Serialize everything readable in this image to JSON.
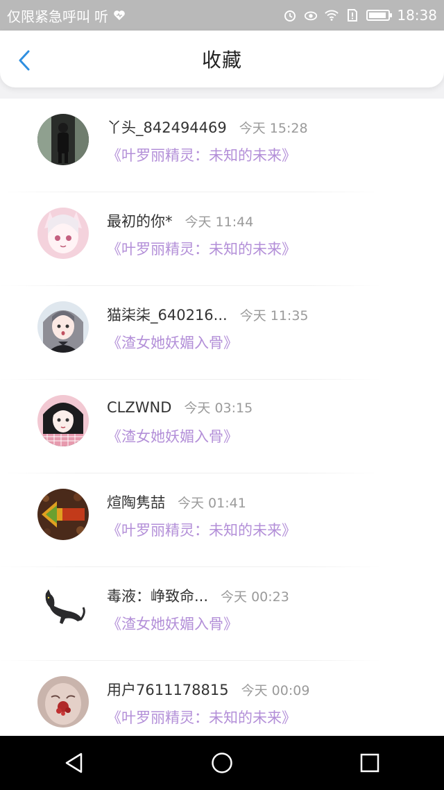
{
  "status_bar": {
    "left_text": "仅限紧急呼叫",
    "carrier_icon": "听",
    "time": "18:38",
    "icons": [
      "heart-icon",
      "alarm-icon",
      "eye-icon",
      "wifi-icon",
      "sim-alert-icon",
      "battery-icon"
    ]
  },
  "header": {
    "title": "收藏",
    "back_icon": "chevron-left-icon",
    "accent_color": "#2f8fe0"
  },
  "items": [
    {
      "username": "丫头_842494469",
      "time": "今天 15:28",
      "book": "《叶罗丽精灵：未知的未来》"
    },
    {
      "username": "最初的你*",
      "time": "今天 11:44",
      "book": "《叶罗丽精灵：未知的未来》"
    },
    {
      "username": "猫柒柒_640216...",
      "time": "今天 11:35",
      "book": "《渣女她妖媚入骨》"
    },
    {
      "username": "CLZWND",
      "time": "今天 03:15",
      "book": "《渣女她妖媚入骨》"
    },
    {
      "username": "煊陶隽喆",
      "time": "今天 01:41",
      "book": "《叶罗丽精灵：未知的未来》"
    },
    {
      "username": "毒液：峥致命...",
      "time": "今天 00:23",
      "book": "《渣女她妖媚入骨》"
    },
    {
      "username": "用户7611178815",
      "time": "今天 00:09",
      "book": "《叶罗丽精灵：未知的未来》"
    }
  ],
  "colors": {
    "book_link": "#b38fd8",
    "time_text": "#9a9a9a",
    "status_bar_bg": "#b9b9b9",
    "nav_bar_bg": "#000000"
  },
  "nav_bar": {
    "buttons": [
      "back-triangle-icon",
      "home-circle-icon",
      "recents-square-icon"
    ]
  }
}
